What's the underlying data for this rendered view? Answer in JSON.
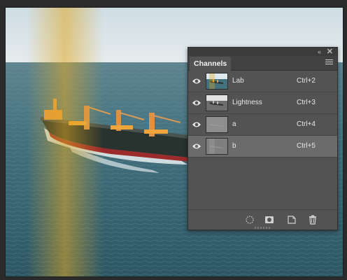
{
  "panel": {
    "tab_label": "Channels",
    "collapse_glyph": "«",
    "close_glyph": "✕",
    "channels": [
      {
        "name": "Lab",
        "shortcut": "Ctrl+2",
        "selected": false,
        "thumb": "composite"
      },
      {
        "name": "Lightness",
        "shortcut": "Ctrl+3",
        "selected": false,
        "thumb": "lightness"
      },
      {
        "name": "a",
        "shortcut": "Ctrl+4",
        "selected": false,
        "thumb": "a"
      },
      {
        "name": "b",
        "shortcut": "Ctrl+5",
        "selected": true,
        "thumb": "b"
      }
    ],
    "footer_icons": [
      "load-selection-icon",
      "save-selection-icon",
      "new-channel-icon",
      "trash-icon"
    ]
  },
  "colors": {
    "app_bg": "#2b2b2b",
    "panel_bg": "#535353",
    "selected_row": "#6b6b6b",
    "sea": "#3d6a78",
    "sky": "#dfe8ec",
    "hull": "#2c3631",
    "crane": "#e89c3e"
  }
}
